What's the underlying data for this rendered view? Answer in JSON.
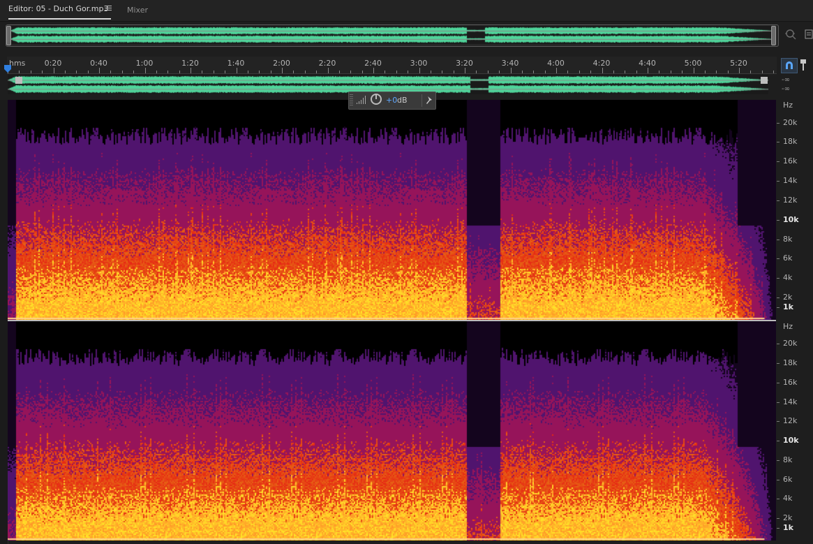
{
  "tabs": {
    "editor_label": "Editor: 05 - Duch Gor.mp3",
    "mixer_label": "Mixer"
  },
  "timeline": {
    "unit_label": "hms",
    "ticks": [
      "0:20",
      "0:40",
      "1:00",
      "1:20",
      "1:40",
      "2:00",
      "2:20",
      "2:40",
      "3:00",
      "3:20",
      "3:40",
      "4:00",
      "4:20",
      "4:40",
      "5:00",
      "5:20"
    ],
    "duration_seconds": 347
  },
  "levels": {
    "top_channel": "-∞",
    "bottom_channel": "-∞"
  },
  "hud": {
    "gain_value": "+0",
    "gain_unit": "dB"
  },
  "frequency_axis": {
    "unit_label": "Hz",
    "labels": [
      "20k",
      "18k",
      "16k",
      "14k",
      "12k",
      "10k",
      "8k",
      "6k",
      "4k",
      "2k",
      "1k"
    ],
    "bold_labels": [
      "10k",
      "1k"
    ]
  },
  "colors": {
    "waveform": "#4fd49a",
    "playhead": "#2f7fe0",
    "spectrogram_low": "#ffb347",
    "spectrogram_mid": "#d42a1c",
    "spectrogram_high": "#5a1a78",
    "hud_gain": "#5fa8ff"
  }
}
